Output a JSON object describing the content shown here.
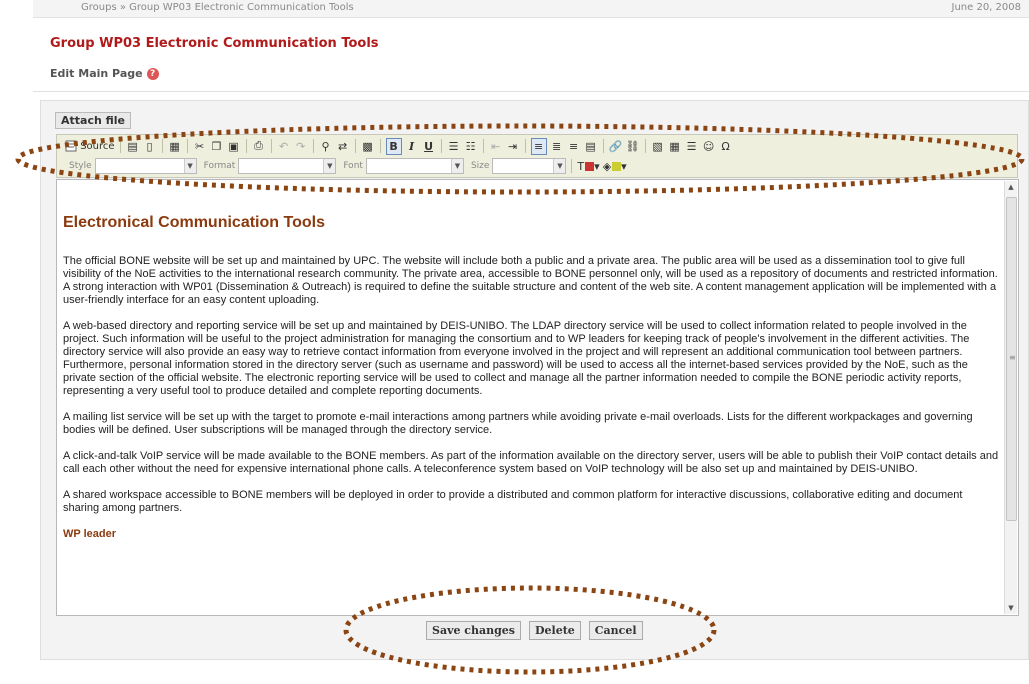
{
  "header": {
    "breadcrumb": "Groups » Group WP03 Electronic Communication Tools",
    "date": "June 20, 2008"
  },
  "page_title": "Group WP03 Electronic Communication Tools",
  "subtitle": "Edit Main Page",
  "help_glyph": "?",
  "attach_label": "Attach file",
  "toolbar": {
    "source_label": "Source",
    "bold": "B",
    "italic": "I",
    "underline": "U",
    "style_label": "Style",
    "format_label": "Format",
    "font_label": "Font",
    "size_label": "Size"
  },
  "content": {
    "heading": "Electronical Communication Tools",
    "paragraphs": [
      "The official BONE website will be set up and maintained by UPC. The website will include both a public and a private area. The public area will be used as a dissemination tool to give full visibility of the NoE activities to the international research community. The private area, accessible to BONE personnel only, will be used as a repository of documents and restricted information. A strong interaction with WP01 (Dissemination & Outreach) is required to define the suitable structure and content of the web site. A content management application will be implemented with a user-friendly interface for an easy content uploading.",
      "A web-based directory and reporting service will be set up and maintained by DEIS-UNIBO. The LDAP directory service will be used to collect information related to people involved in the project. Such information will be useful to the project administration for managing the consortium and to WP leaders for keeping track of people's involvement in the different activities. The directory service will also provide an easy way to retrieve contact information from everyone involved in the project and will represent an additional communication tool between partners. Furthermore, personal information stored in the directory server (such as username and password) will be used to access all the internet-based services provided by the NoE, such as the private section of the official website. The electronic reporting service will be used to collect and manage all the partner information needed to compile the BONE periodic activity reports, representing a very useful tool to produce detailed and complete reporting documents.",
      "A mailing list service will be set up with the target to promote e-mail interactions among partners while avoiding private e-mail overloads. Lists for the different workpackages and governing bodies will be defined. User subscriptions will be managed through the directory service.",
      "A click-and-talk VoIP service will be made available to the BONE members. As part of the information available on the directory server, users will be able to publish their VoIP contact details and call each other without the need for expensive international phone calls. A teleconference system based on VoIP technology will be also set up and maintained by DEIS-UNIBO.",
      "A shared workspace accessible to BONE members will be deployed in order to provide a distributed and common platform for interactive discussions, collaborative editing and document sharing among partners."
    ],
    "wp_leader": "WP leader"
  },
  "buttons": {
    "save": "Save changes",
    "delete": "Delete",
    "cancel": "Cancel"
  },
  "colors": {
    "title": "#b01a1a",
    "heading": "#8b3a0f",
    "annotation": "#8b4513",
    "toolbar_bg": "#efefde"
  }
}
